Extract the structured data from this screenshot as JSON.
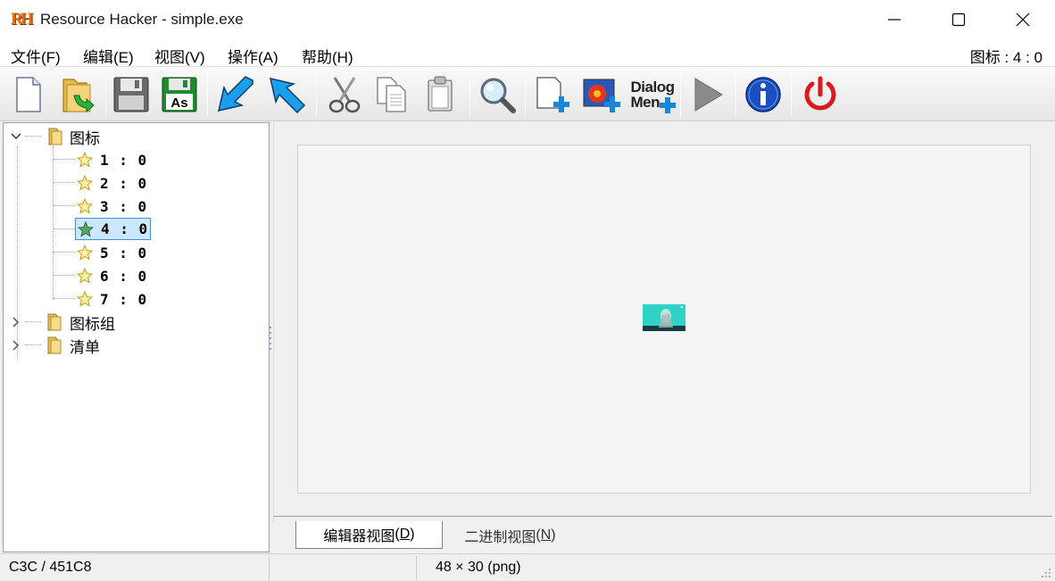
{
  "window": {
    "app_logo": "RH",
    "title": "Resource Hacker - simple.exe"
  },
  "menu": {
    "items": [
      "文件(F)",
      "编辑(E)",
      "视图(V)",
      "操作(A)",
      "帮助(H)"
    ],
    "right_status": "图标 : 4 : 0"
  },
  "toolbar": {
    "icons": [
      "new-file-icon",
      "open-file-icon",
      "save-icon",
      "save-as-icon",
      "back-arrow-icon",
      "forward-arrow-icon",
      "cut-icon",
      "copy-icon",
      "paste-icon",
      "search-icon",
      "add-blank-resource-icon",
      "add-image-resource-icon",
      "dialog-menu-icon",
      "run-script-icon",
      "info-icon",
      "exit-icon"
    ],
    "save_as_label": "As",
    "dialog_label_line1": "Dialog",
    "dialog_label_line2": "Men"
  },
  "tree": {
    "root": {
      "label": "图标",
      "children": [
        "1 : 0",
        "2 : 0",
        "3 : 0",
        "4 : 0",
        "5 : 0",
        "6 : 0",
        "7 : 0"
      ],
      "selected": "4 : 0"
    },
    "others": [
      "图标组",
      "清单"
    ]
  },
  "tabs": {
    "editor_view": "编辑器视图",
    "editor_view_key": "D",
    "binary_view": "二进制视图",
    "binary_view_key": "N"
  },
  "status": {
    "offset": "C3C / 451C8",
    "info": "48 × 30 (png)"
  },
  "colors": {
    "selection_bg": "#cce8ff",
    "selection_border": "#4a90d0",
    "thumb_teal": "#2ed3c6"
  }
}
